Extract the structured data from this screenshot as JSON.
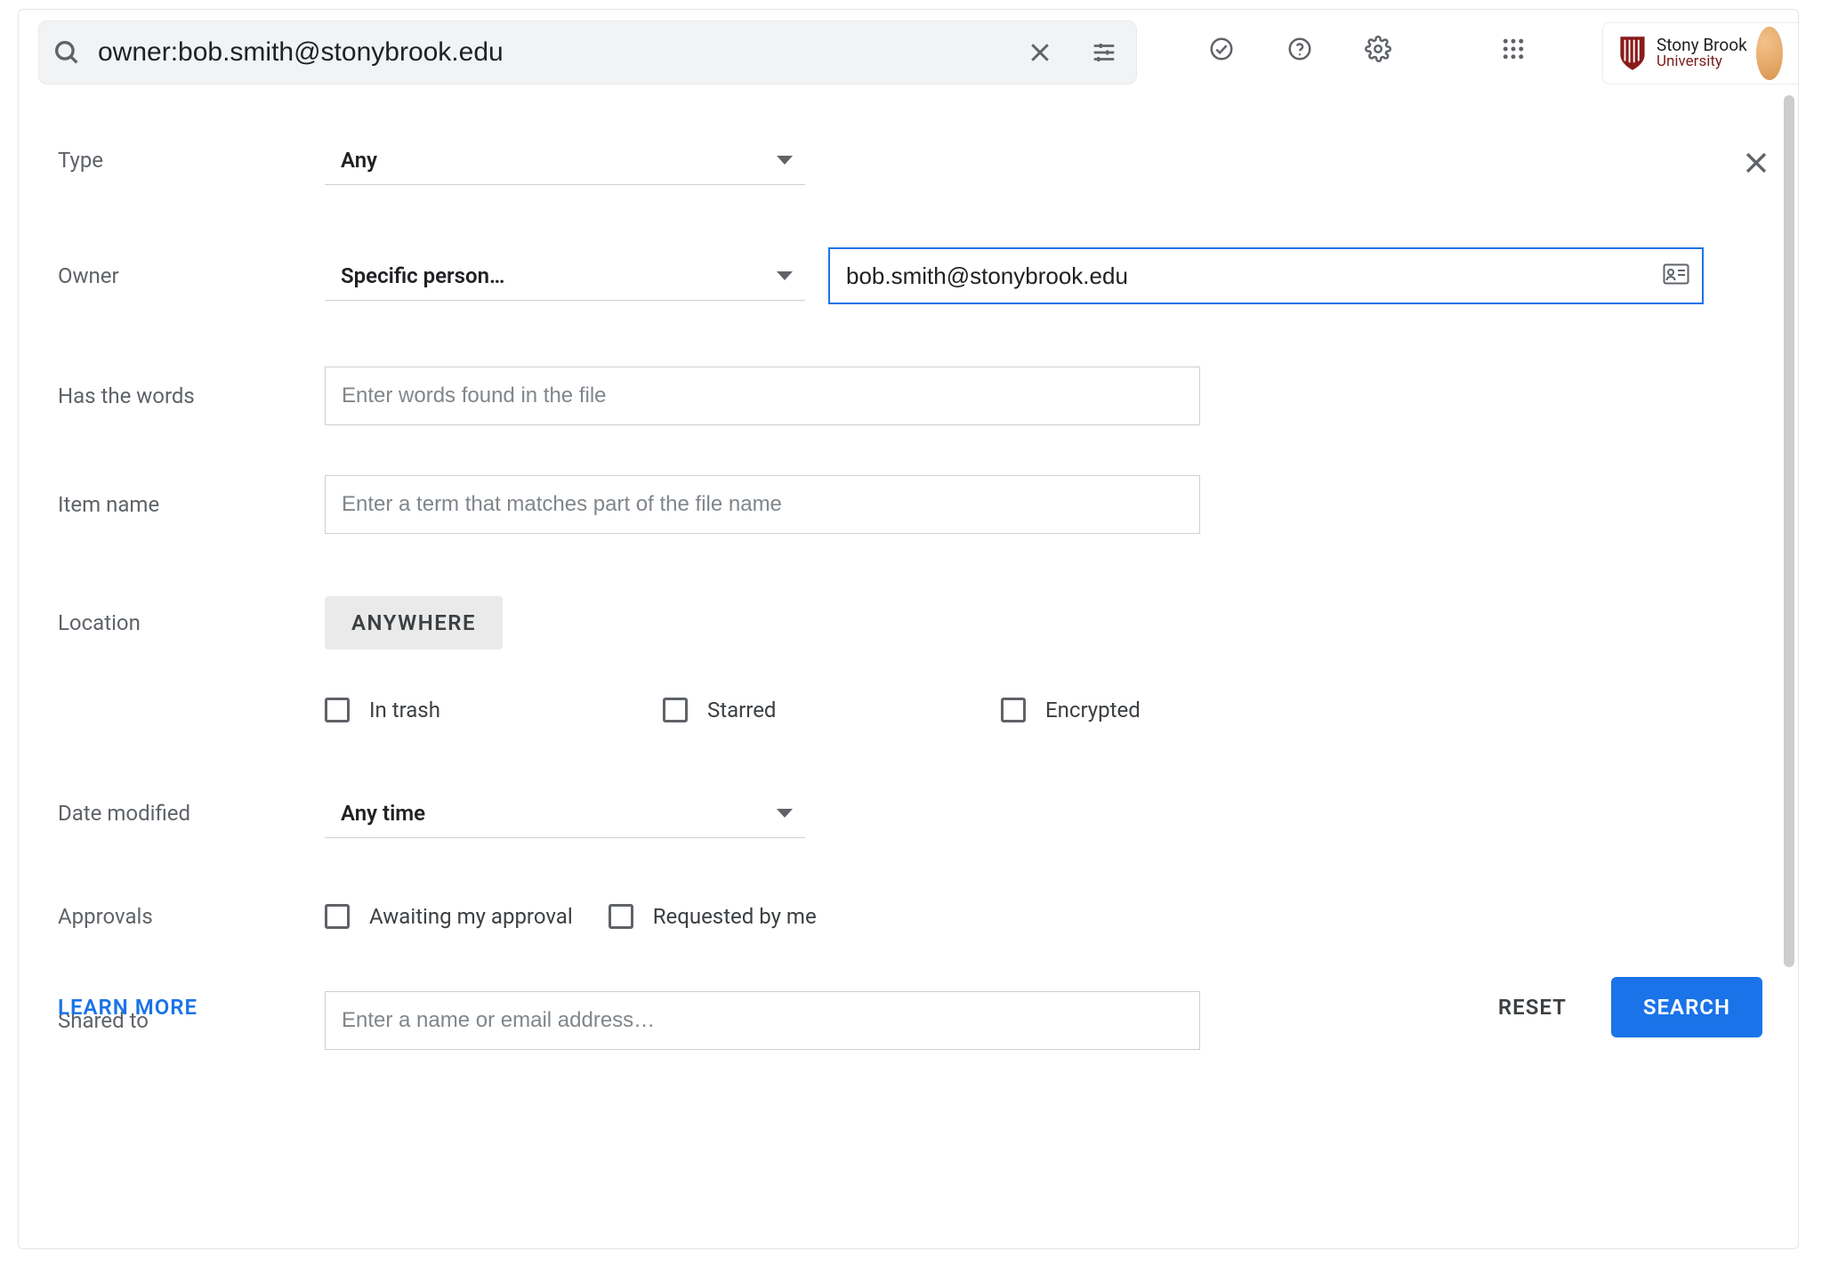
{
  "search": {
    "query": "owner:bob.smith@stonybrook.edu"
  },
  "brand": {
    "line1": "Stony Brook",
    "line2": "University"
  },
  "form": {
    "type": {
      "label": "Type",
      "value": "Any"
    },
    "owner": {
      "label": "Owner",
      "value": "Specific person…",
      "person": "bob.smith@stonybrook.edu"
    },
    "has_words": {
      "label": "Has the words",
      "placeholder": "Enter words found in the file"
    },
    "item_name": {
      "label": "Item name",
      "placeholder": "Enter a term that matches part of the file name"
    },
    "location": {
      "label": "Location",
      "value": "ANYWHERE",
      "flags": [
        "In trash",
        "Starred",
        "Encrypted"
      ]
    },
    "date_modified": {
      "label": "Date modified",
      "value": "Any time"
    },
    "approvals": {
      "label": "Approvals",
      "flags": [
        "Awaiting my approval",
        "Requested by me"
      ]
    },
    "shared_to": {
      "label": "Shared to",
      "placeholder": "Enter a name or email address…"
    }
  },
  "footer": {
    "learn_more": "LEARN MORE",
    "reset": "RESET",
    "search": "SEARCH"
  }
}
